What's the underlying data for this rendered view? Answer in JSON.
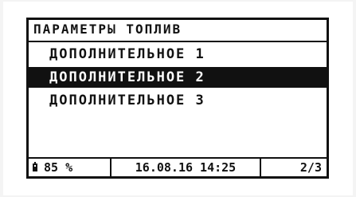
{
  "screen": {
    "title": "ПАРАМЕТРЫ ТОПЛИВ",
    "menu_items": [
      {
        "label": "ДОПОЛНИТЕЛЬНОЕ 1"
      },
      {
        "label": "ДОПОЛНИТЕЛЬНОЕ 2"
      },
      {
        "label": "ДОПОЛНИТЕЛЬНОЕ 3"
      }
    ],
    "selected_index": 1,
    "status": {
      "battery_icon": "battery-icon",
      "battery": "85 %",
      "datetime": "16.08.16 14:25",
      "page": "2/3"
    }
  }
}
